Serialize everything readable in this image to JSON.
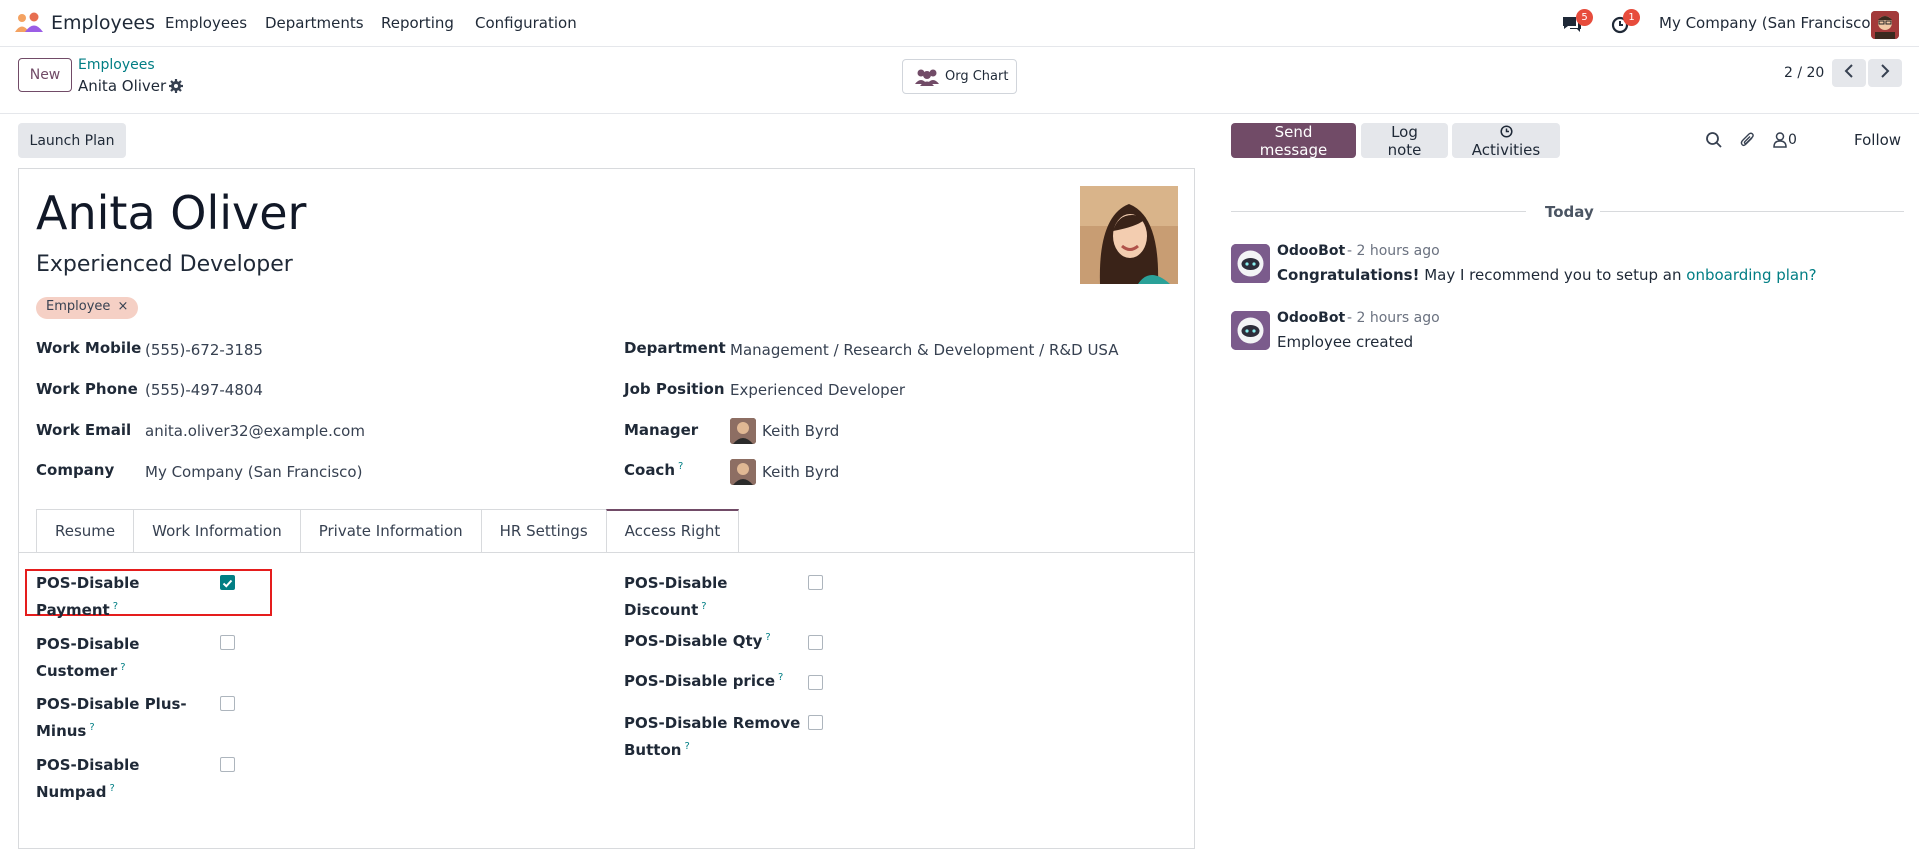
{
  "navbar": {
    "app_name": "Employees",
    "menu": [
      "Employees",
      "Departments",
      "Reporting",
      "Configuration"
    ],
    "messages_badge": "5",
    "activities_badge": "1",
    "company": "My Company (San Francisco)"
  },
  "control_panel": {
    "new_label": "New",
    "breadcrumb_parent": "Employees",
    "breadcrumb_current": "Anita Oliver",
    "org_chart_label": "Org Chart",
    "pager": "2 / 20",
    "prev_icon": "chevron-left-icon",
    "next_icon": "chevron-right-icon"
  },
  "actions": {
    "launch_plan": "Launch Plan"
  },
  "employee": {
    "name": "Anita Oliver",
    "job_title": "Experienced Developer",
    "tag": "Employee",
    "tag_remove": "×",
    "fields_left": [
      {
        "label": "Work Mobile",
        "value": "(555)-672-3185"
      },
      {
        "label": "Work Phone",
        "value": "(555)-497-4804"
      },
      {
        "label": "Work Email",
        "value": "anita.oliver32@example.com"
      },
      {
        "label": "Company",
        "value": "My Company (San Francisco)"
      }
    ],
    "fields_right": [
      {
        "label": "Department",
        "value": "Management / Research & Development / R&D USA"
      },
      {
        "label": "Job Position",
        "value": "Experienced Developer"
      },
      {
        "label": "Manager",
        "value": "Keith Byrd"
      },
      {
        "label": "Coach",
        "value": "Keith Byrd"
      }
    ],
    "help_mark": "?"
  },
  "tabs": [
    "Resume",
    "Work Information",
    "Private Information",
    "HR Settings",
    "Access Right"
  ],
  "active_tab": "Access Right",
  "access_rights_left": [
    {
      "line1": "POS-Disable",
      "line2": "Payment",
      "checked": true
    },
    {
      "line1": "POS-Disable",
      "line2": "Customer",
      "checked": false
    },
    {
      "line1": "POS-Disable Plus-",
      "line2": "Minus",
      "checked": false
    },
    {
      "line1": "POS-Disable",
      "line2": "Numpad",
      "checked": false
    }
  ],
  "access_rights_right": [
    {
      "line1": "POS-Disable",
      "line2": "Discount",
      "checked": false
    },
    {
      "line1": "POS-Disable Qty",
      "line2": "",
      "checked": false
    },
    {
      "line1": "POS-Disable price",
      "line2": "",
      "checked": false
    },
    {
      "line1": "POS-Disable Remove",
      "line2": "Button",
      "checked": false
    }
  ],
  "chatter": {
    "send_message": "Send message",
    "log_note": "Log note",
    "activities": "Activities",
    "followers_count": "0",
    "follow": "Follow",
    "day_separator": "Today",
    "messages": [
      {
        "author": "OdooBot",
        "time": "- 2 hours ago",
        "bold": "Congratulations!",
        "text": " May I recommend you to setup an ",
        "link": "onboarding plan?"
      },
      {
        "author": "OdooBot",
        "time": "- 2 hours ago",
        "bold": "",
        "text": "Employee created",
        "link": ""
      }
    ]
  },
  "colors": {
    "brand": "#714b67",
    "link": "#017e84",
    "badge": "#e74c3c",
    "highlight": "#e51d1d"
  }
}
